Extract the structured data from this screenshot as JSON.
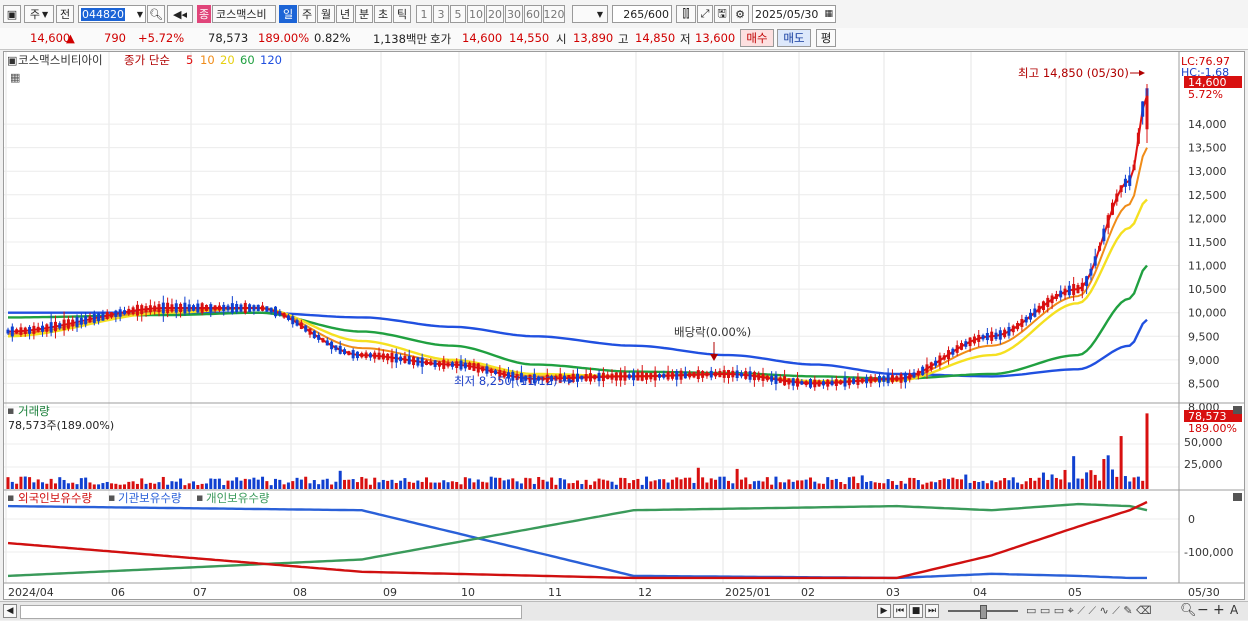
{
  "toolbar": {
    "market": "주",
    "prev": "전",
    "code": "044820",
    "name_tag": "종",
    "stock_name": "코스맥스비",
    "periods": [
      "일",
      "주",
      "월",
      "년",
      "분",
      "초",
      "틱"
    ],
    "active_period": "일",
    "intervals": [
      "1",
      "3",
      "5",
      "10",
      "20",
      "30",
      "60",
      "120"
    ],
    "count": "265",
    "count_total": "/600",
    "date": "2025/05/30"
  },
  "quote": {
    "price": "14,600",
    "change": "790",
    "change_pct": "+5.72%",
    "volume": "78,573",
    "volume_ratio": "189.00%",
    "turnover": "0.82%",
    "amount": "1,138백만",
    "ask_label": "호가",
    "ask": "14,600",
    "bid": "14,550",
    "open_label": "시",
    "open": "13,890",
    "high_label": "고",
    "high": "14,850",
    "low_label": "저",
    "low": "13,600",
    "buy": "매수",
    "sell": "매도",
    "avg": "평"
  },
  "price_panel": {
    "name_label": "코스맥스비티아이",
    "ma_label": "종가 단순",
    "ma_periods": [
      "5",
      "10",
      "20",
      "60",
      "120"
    ],
    "lc": "LC:76.97",
    "hc": "HC:-1.68",
    "last_price": "14,600",
    "last_pct": "5.72%",
    "high_annot": "최고 14,850 (05/30)",
    "low_annot": "최저 8,250 (11/12)",
    "dividend_annot": "배당락(0.00%)",
    "yticks": [
      "14,000",
      "13,500",
      "13,000",
      "12,500",
      "12,000",
      "11,500",
      "11,000",
      "10,500",
      "10,000",
      "9,500",
      "9,000",
      "8,500",
      "8,000"
    ]
  },
  "volume_panel": {
    "title": "거래량",
    "value": "78,573주(189.00%)",
    "last_value": "78,573",
    "last_pct": "189.00%",
    "yticks": [
      "50,000",
      "25,000"
    ]
  },
  "holdings_panel": {
    "series_labels": [
      "외국인보유수량",
      "기관보유수량",
      "개인보유수량"
    ],
    "yticks": [
      "0",
      "-100,000"
    ]
  },
  "xaxis": {
    "labels": [
      "2024/04",
      "06",
      "07",
      "08",
      "09",
      "10",
      "11",
      "12",
      "2025/01",
      "02",
      "03",
      "04",
      "05"
    ],
    "right_label": "05/30"
  },
  "colors": {
    "ma5": "#e01010",
    "ma10": "#f08c18",
    "ma20": "#f5e020",
    "ma60": "#20a040",
    "ma120": "#2050e0",
    "up": "#d81010",
    "down": "#1040d0",
    "foreign": "#d01010",
    "institution": "#2a60d8",
    "individual": "#3a9a5a"
  },
  "chart_data": [
    {
      "type": "line",
      "title": "코스맥스비티아이 종가 단순",
      "series": [
        {
          "name": "5",
          "x": [
            "2024/04",
            "2024/06",
            "2024/07",
            "2024/08",
            "2024/09",
            "2024/10",
            "2024/11",
            "2024/12",
            "2025/01",
            "2025/02",
            "2025/03",
            "2025/04",
            "2025/05",
            "05/30"
          ],
          "values": [
            9600,
            10100,
            10100,
            9100,
            8900,
            8600,
            8650,
            8700,
            8500,
            8600,
            9500,
            10500,
            12800,
            14600
          ]
        },
        {
          "name": "20",
          "x": [
            "2024/04",
            "2024/06",
            "2024/07",
            "2024/08",
            "2024/09",
            "2024/10",
            "2024/11",
            "2024/12",
            "2025/01",
            "2025/02",
            "2025/03",
            "2025/04",
            "2025/05",
            "05/30"
          ],
          "values": [
            9500,
            10000,
            10100,
            9400,
            9000,
            8700,
            8650,
            8700,
            8550,
            8560,
            9100,
            10200,
            11800,
            12400
          ]
        },
        {
          "name": "60",
          "x": [
            "2024/04",
            "2024/06",
            "2024/07",
            "2024/08",
            "2024/09",
            "2024/10",
            "2024/11",
            "2024/12",
            "2025/01",
            "2025/02",
            "2025/03",
            "2025/04",
            "2025/05",
            "05/30"
          ],
          "values": [
            9900,
            9950,
            10000,
            9600,
            9300,
            8900,
            8750,
            8720,
            8650,
            8600,
            8700,
            9100,
            10300,
            11000
          ]
        },
        {
          "name": "120",
          "x": [
            "2024/04",
            "2024/06",
            "2024/07",
            "2024/08",
            "2024/09",
            "2024/10",
            "2024/11",
            "2024/12",
            "2025/01",
            "2025/02",
            "2025/03",
            "2025/04",
            "2025/05",
            "05/30"
          ],
          "values": [
            10000,
            10000,
            10000,
            9900,
            9700,
            9500,
            9300,
            9100,
            8900,
            8700,
            8650,
            8800,
            9300,
            9850
          ]
        }
      ],
      "ylim": [
        8000,
        14850
      ]
    },
    {
      "type": "bar",
      "title": "거래량",
      "x": [
        "2024/04",
        "2024/07",
        "2024/08",
        "2024/11",
        "2025/03",
        "2025/04",
        "2025/05",
        "05/30"
      ],
      "values": [
        12000,
        15000,
        14000,
        13000,
        16000,
        23000,
        55000,
        78573
      ],
      "ylim": [
        0,
        80000
      ]
    },
    {
      "type": "line",
      "series": [
        {
          "name": "외국인보유수량",
          "x": [
            "2024/04",
            "2024/08",
            "2024/11",
            "2025/02",
            "2025/03",
            "2025/04",
            "2025/05",
            "05/30"
          ],
          "values": [
            -80000,
            -150000,
            -165000,
            -165000,
            -110000,
            -40000,
            0,
            20000
          ]
        },
        {
          "name": "기관보유수량",
          "x": [
            "2024/04",
            "2024/08",
            "2024/11",
            "2025/02",
            "2025/03",
            "2025/04",
            "2025/05",
            "05/30"
          ],
          "values": [
            10000,
            0,
            -160000,
            -165000,
            -155000,
            -160000,
            -165000,
            -165000
          ]
        },
        {
          "name": "개인보유수량",
          "x": [
            "2024/04",
            "2024/08",
            "2024/11",
            "2025/02",
            "2025/03",
            "2025/04",
            "2025/05",
            "05/30"
          ],
          "values": [
            -160000,
            -120000,
            0,
            10000,
            0,
            15000,
            10000,
            0
          ]
        }
      ]
    }
  ],
  "scroll": {
    "ticks": [
      "1",
      "2",
      "3",
      "4",
      "5",
      "6",
      "7",
      "8",
      "9",
      "10",
      "11",
      "12",
      "13",
      "14",
      "15",
      "16",
      "17",
      "18",
      "19",
      "20",
      "21",
      "22",
      "23",
      "24",
      "25",
      "26",
      "27",
      "28",
      "29",
      "30",
      "31",
      "32",
      "33",
      "34",
      "35",
      "36",
      "37",
      "38",
      "39",
      "40",
      "41",
      "42",
      "43",
      "44",
      "45",
      "46",
      "47",
      "48",
      "49",
      "50",
      "51",
      "52",
      "53",
      "54",
      "55",
      "56",
      "57",
      "58",
      "59",
      "60"
    ]
  }
}
